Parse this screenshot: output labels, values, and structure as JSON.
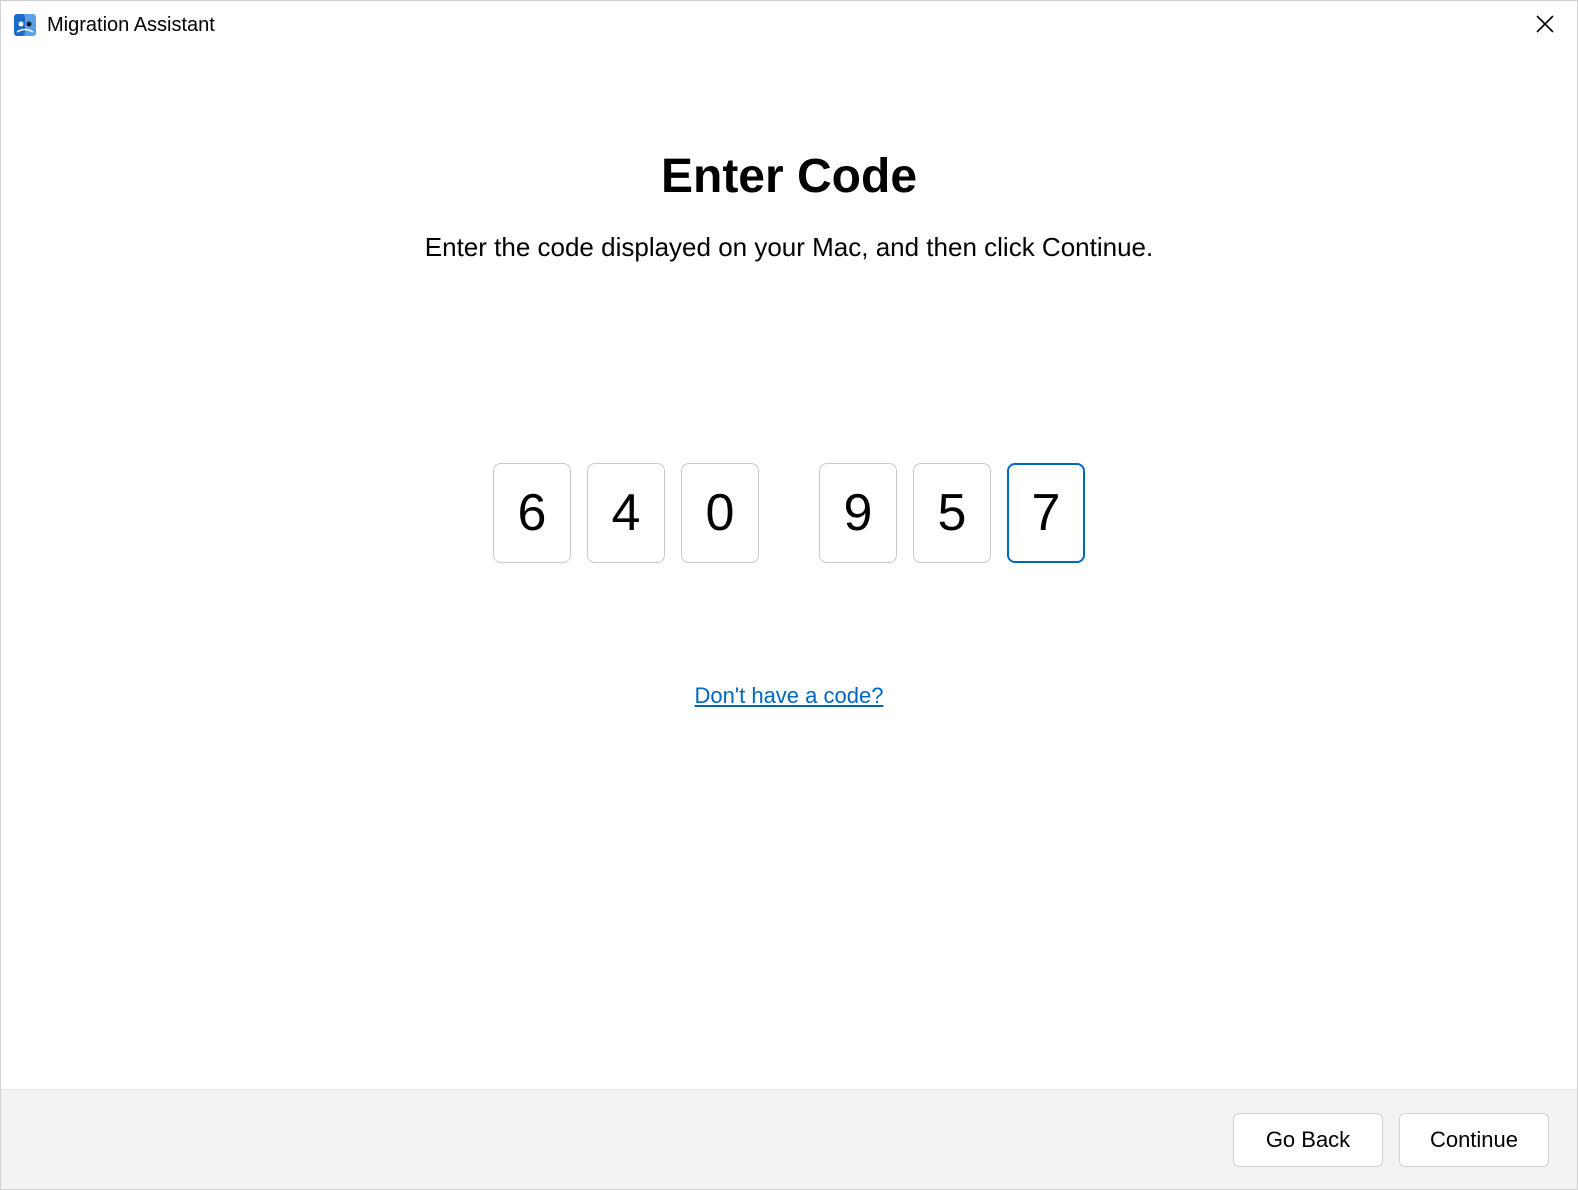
{
  "window": {
    "title": "Migration Assistant"
  },
  "main": {
    "heading": "Enter Code",
    "subheading": "Enter the code displayed on your Mac, and then click Continue.",
    "code_digits": [
      "6",
      "4",
      "0",
      "9",
      "5",
      "7"
    ],
    "active_digit_index": 5,
    "help_link_label": "Don't have a code?"
  },
  "footer": {
    "go_back_label": "Go Back",
    "continue_label": "Continue"
  },
  "icons": {
    "app_icon": "migration-assistant-icon",
    "close_icon": "close-icon"
  }
}
